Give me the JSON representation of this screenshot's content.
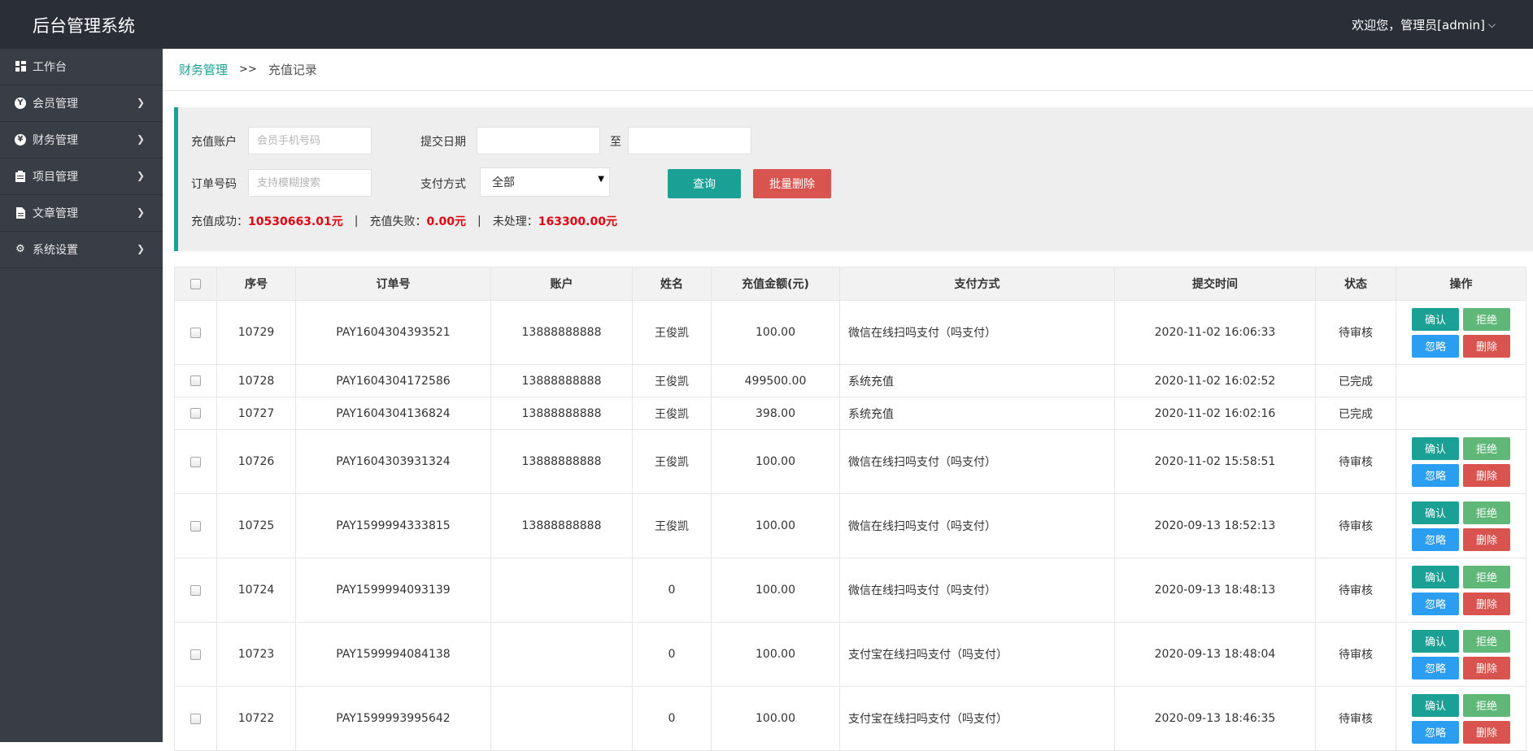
{
  "app": {
    "title": "后台管理系统",
    "welcome": "欢迎您，管理员[admin]"
  },
  "sidebar": {
    "items": [
      {
        "label": "工作台",
        "icon": "dashboard-icon",
        "expandable": false
      },
      {
        "label": "会员管理",
        "icon": "member-icon",
        "expandable": true
      },
      {
        "label": "财务管理",
        "icon": "finance-icon",
        "expandable": true
      },
      {
        "label": "项目管理",
        "icon": "clipboard-icon",
        "expandable": true
      },
      {
        "label": "文章管理",
        "icon": "document-icon",
        "expandable": true
      },
      {
        "label": "系统设置",
        "icon": "gear-icon",
        "expandable": true
      }
    ]
  },
  "breadcrumb": {
    "parent": "财务管理",
    "separator": ">>",
    "current": "充值记录"
  },
  "filter": {
    "account_label": "充值账户",
    "account_placeholder": "会员手机号码",
    "date_label": "提交日期",
    "date_to": "至",
    "order_label": "订单号码",
    "order_placeholder": "支持模糊搜索",
    "pay_label": "支付方式",
    "pay_value": "全部",
    "search_button": "查询",
    "batch_delete_button": "批量删除"
  },
  "summary": {
    "success_label": "充值成功：",
    "success_value": "10530663.01元",
    "fail_label": "充值失败：",
    "fail_value": "0.00元",
    "pending_label": "未处理：",
    "pending_value": "163300.00元",
    "divider": "|"
  },
  "table": {
    "headers": [
      "序号",
      "订单号",
      "账户",
      "姓名",
      "充值金额(元)",
      "支付方式",
      "提交时间",
      "状态",
      "操作"
    ],
    "op_labels": {
      "confirm": "确认",
      "reject": "拒绝",
      "ignore": "忽略",
      "delete": "删除"
    },
    "rows": [
      {
        "id": "10729",
        "order": "PAY1604304393521",
        "account": "13888888888",
        "name": "王俊凯",
        "amount": "100.00",
        "method": "微信在线扫吗支付（吗支付）",
        "time": "2020-11-02 16:06:33",
        "status": "待审核",
        "ops": true
      },
      {
        "id": "10728",
        "order": "PAY1604304172586",
        "account": "13888888888",
        "name": "王俊凯",
        "amount": "499500.00",
        "method": "系统充值",
        "time": "2020-11-02 16:02:52",
        "status": "已完成",
        "ops": false
      },
      {
        "id": "10727",
        "order": "PAY1604304136824",
        "account": "13888888888",
        "name": "王俊凯",
        "amount": "398.00",
        "method": "系统充值",
        "time": "2020-11-02 16:02:16",
        "status": "已完成",
        "ops": false
      },
      {
        "id": "10726",
        "order": "PAY1604303931324",
        "account": "13888888888",
        "name": "王俊凯",
        "amount": "100.00",
        "method": "微信在线扫吗支付（吗支付）",
        "time": "2020-11-02 15:58:51",
        "status": "待审核",
        "ops": true
      },
      {
        "id": "10725",
        "order": "PAY1599994333815",
        "account": "13888888888",
        "name": "王俊凯",
        "amount": "100.00",
        "method": "微信在线扫吗支付（吗支付）",
        "time": "2020-09-13 18:52:13",
        "status": "待审核",
        "ops": true
      },
      {
        "id": "10724",
        "order": "PAY1599994093139",
        "account": "",
        "name": "0",
        "amount": "100.00",
        "method": "微信在线扫吗支付（吗支付）",
        "time": "2020-09-13 18:48:13",
        "status": "待审核",
        "ops": true
      },
      {
        "id": "10723",
        "order": "PAY1599994084138",
        "account": "",
        "name": "0",
        "amount": "100.00",
        "method": "支付宝在线扫吗支付（吗支付）",
        "time": "2020-09-13 18:48:04",
        "status": "待审核",
        "ops": true
      },
      {
        "id": "10722",
        "order": "PAY1599993995642",
        "account": "",
        "name": "0",
        "amount": "100.00",
        "method": "支付宝在线扫吗支付（吗支付）",
        "time": "2020-09-13 18:46:35",
        "status": "待审核",
        "ops": true
      }
    ]
  }
}
